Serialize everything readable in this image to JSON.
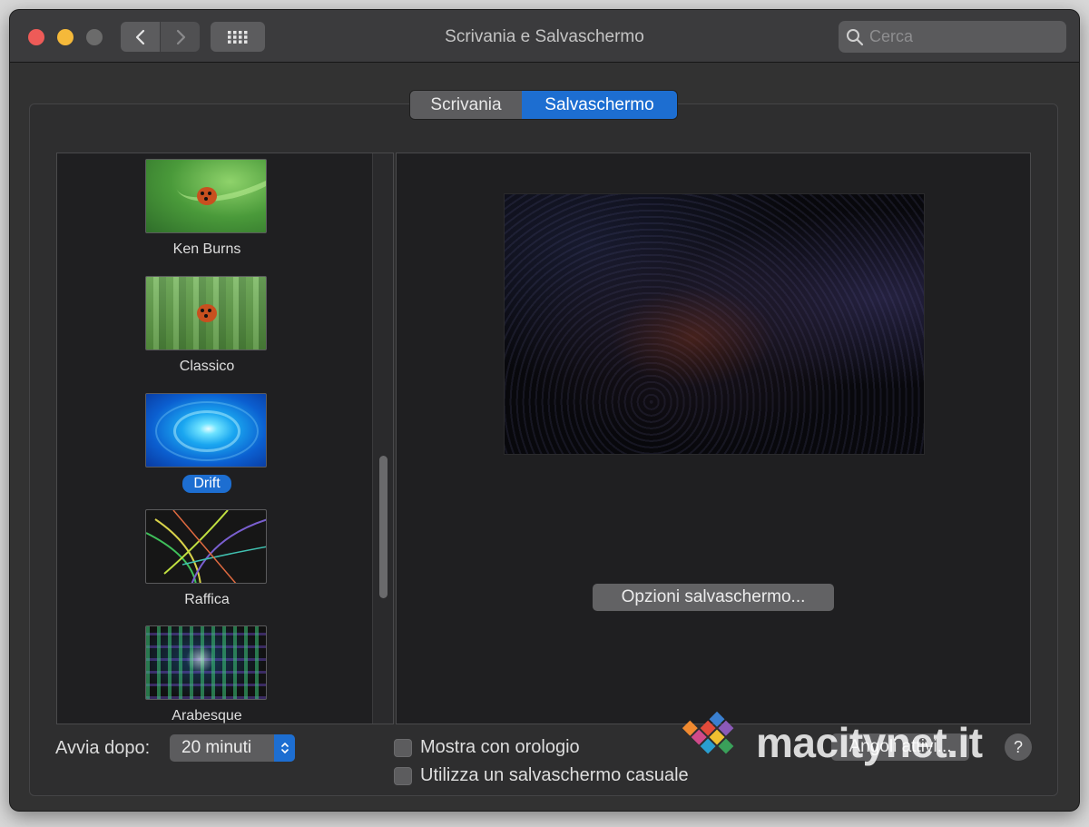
{
  "window": {
    "title": "Scrivania e Salvaschermo"
  },
  "search": {
    "placeholder": "Cerca"
  },
  "tabs": [
    {
      "label": "Scrivania",
      "selected": false
    },
    {
      "label": "Salvaschermo",
      "selected": true
    }
  ],
  "screensavers": [
    {
      "label": "Ken Burns",
      "thumb": "kenburns",
      "selected": false
    },
    {
      "label": "Classico",
      "thumb": "classico",
      "selected": false
    },
    {
      "label": "Drift",
      "thumb": "drift",
      "selected": true
    },
    {
      "label": "Raffica",
      "thumb": "raffica",
      "selected": false
    },
    {
      "label": "Arabesque",
      "thumb": "arabesque",
      "selected": false
    }
  ],
  "preview": {
    "options_button": "Opzioni salvaschermo..."
  },
  "bottom": {
    "start_after_label": "Avvia dopo:",
    "start_after_value": "20 minuti",
    "show_clock_label": "Mostra con orologio",
    "show_clock_checked": false,
    "random_label": "Utilizza un salvaschermo casuale",
    "random_checked": false,
    "hot_corners_button": "Angoli attivi...",
    "help_button": "?"
  },
  "watermark": {
    "text": "macitynet.it"
  },
  "colors": {
    "accent": "#1d6ed1",
    "window_bg": "#323232",
    "panel_bg": "#1f1f21"
  },
  "icons": [
    "back-chevron-icon",
    "forward-chevron-icon",
    "grid-icon",
    "search-icon",
    "popup-arrows-icon"
  ]
}
